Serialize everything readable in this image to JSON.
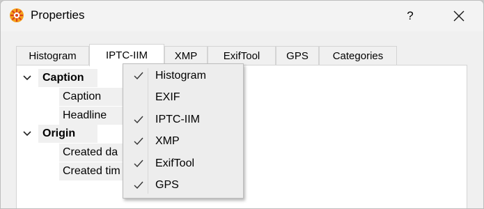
{
  "window": {
    "title": "Properties",
    "help_label": "?",
    "app_icon": "xnview-logo-icon",
    "close_icon": "close-icon"
  },
  "tabs": [
    {
      "label": "Histogram",
      "active": false
    },
    {
      "label": "IPTC-IIM",
      "active": true
    },
    {
      "label": "XMP",
      "active": false
    },
    {
      "label": "ExifTool",
      "active": false
    },
    {
      "label": "GPS",
      "active": false
    },
    {
      "label": "Categories",
      "active": false
    }
  ],
  "tree": {
    "groups": [
      {
        "label": "Caption",
        "expanded": true,
        "children": [
          "Caption",
          "Headline"
        ]
      },
      {
        "label": "Origin",
        "expanded": true,
        "children": [
          "Created da",
          "Created tim"
        ]
      }
    ]
  },
  "context_menu": {
    "items": [
      {
        "label": "Histogram",
        "checked": true
      },
      {
        "label": "EXIF",
        "checked": false
      },
      {
        "label": "IPTC-IIM",
        "checked": true
      },
      {
        "label": "XMP",
        "checked": true
      },
      {
        "label": "ExifTool",
        "checked": true
      },
      {
        "label": "GPS",
        "checked": true
      }
    ],
    "check_icon": "checkmark-icon"
  },
  "colors": {
    "window_bg": "#f0f0f0",
    "content_bg": "#ffffff",
    "menu_bg": "#ededed",
    "logo_orange": "#f5a11c",
    "logo_red": "#d9421c"
  }
}
